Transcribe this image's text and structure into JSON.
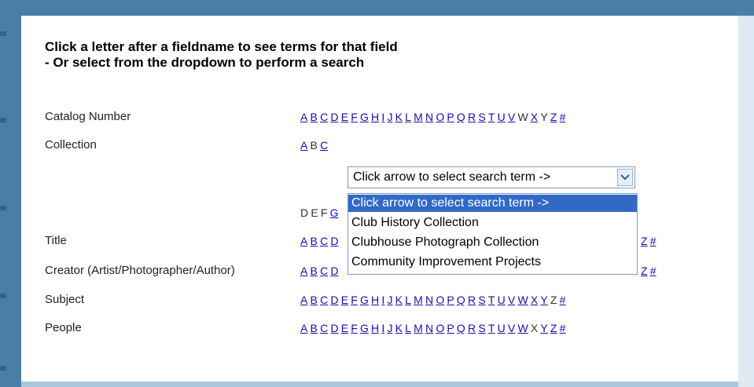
{
  "heading": {
    "line1": "Click a letter after a fieldname to see terms for that field",
    "line2": "- Or select from the dropdown to perform a search"
  },
  "fields": [
    {
      "label": "Catalog Number"
    },
    {
      "label": "Collection"
    },
    {
      "label": "Title"
    },
    {
      "label": "Creator (Artist/Photographer/Author)"
    },
    {
      "label": "Subject"
    },
    {
      "label": "People"
    }
  ],
  "letter_rows": {
    "catalog": [
      {
        "t": "A",
        "link": true
      },
      {
        "t": "B",
        "link": true
      },
      {
        "t": "C",
        "link": true
      },
      {
        "t": "D",
        "link": true
      },
      {
        "t": "E",
        "link": true
      },
      {
        "t": "F",
        "link": true
      },
      {
        "t": "G",
        "link": true
      },
      {
        "t": "H",
        "link": true
      },
      {
        "t": "I",
        "link": true
      },
      {
        "t": "J",
        "link": true
      },
      {
        "t": "K",
        "link": true
      },
      {
        "t": "L",
        "link": true
      },
      {
        "t": "M",
        "link": true
      },
      {
        "t": "N",
        "link": true
      },
      {
        "t": "O",
        "link": true
      },
      {
        "t": "P",
        "link": true
      },
      {
        "t": "Q",
        "link": true
      },
      {
        "t": "R",
        "link": true
      },
      {
        "t": "S",
        "link": true
      },
      {
        "t": "T",
        "link": true
      },
      {
        "t": "U",
        "link": true
      },
      {
        "t": "V",
        "link": true
      },
      {
        "t": "W",
        "link": false
      },
      {
        "t": "X",
        "link": true
      },
      {
        "t": "Y",
        "link": false
      },
      {
        "t": "Z",
        "link": true
      },
      {
        "t": "#",
        "link": true
      }
    ],
    "collection_top": [
      {
        "t": "A",
        "link": true
      },
      {
        "t": "B",
        "link": false
      },
      {
        "t": "C",
        "link": true
      }
    ],
    "collection_bottom": [
      {
        "t": "D",
        "link": false
      },
      {
        "t": "E",
        "link": false
      },
      {
        "t": "F",
        "link": false
      },
      {
        "t": "G",
        "link": true
      }
    ],
    "title": [
      {
        "t": "A",
        "link": true
      },
      {
        "t": "B",
        "link": true
      },
      {
        "t": "C",
        "link": true
      },
      {
        "t": "D",
        "link": true
      }
    ],
    "title_tail": [
      {
        "t": "Z",
        "link": true
      },
      {
        "t": "#",
        "link": true
      }
    ],
    "creator": [
      {
        "t": "A",
        "link": true
      },
      {
        "t": "B",
        "link": true
      },
      {
        "t": "C",
        "link": true
      },
      {
        "t": "D",
        "link": true
      }
    ],
    "creator_tail": [
      {
        "t": "Z",
        "link": true
      },
      {
        "t": "#",
        "link": true
      }
    ],
    "subject": [
      {
        "t": "A",
        "link": true
      },
      {
        "t": "B",
        "link": true
      },
      {
        "t": "C",
        "link": true
      },
      {
        "t": "D",
        "link": true
      },
      {
        "t": "E",
        "link": true
      },
      {
        "t": "F",
        "link": true
      },
      {
        "t": "G",
        "link": true
      },
      {
        "t": "H",
        "link": true
      },
      {
        "t": "I",
        "link": true
      },
      {
        "t": "J",
        "link": true
      },
      {
        "t": "K",
        "link": true
      },
      {
        "t": "L",
        "link": true
      },
      {
        "t": "M",
        "link": true
      },
      {
        "t": "N",
        "link": true
      },
      {
        "t": "O",
        "link": true
      },
      {
        "t": "P",
        "link": true
      },
      {
        "t": "Q",
        "link": true
      },
      {
        "t": "R",
        "link": true
      },
      {
        "t": "S",
        "link": true
      },
      {
        "t": "T",
        "link": true
      },
      {
        "t": "U",
        "link": true
      },
      {
        "t": "V",
        "link": true
      },
      {
        "t": "W",
        "link": true
      },
      {
        "t": "X",
        "link": true
      },
      {
        "t": "Y",
        "link": true
      },
      {
        "t": "Z",
        "link": false
      },
      {
        "t": "#",
        "link": true
      }
    ],
    "people": [
      {
        "t": "A",
        "link": true
      },
      {
        "t": "B",
        "link": true
      },
      {
        "t": "C",
        "link": true
      },
      {
        "t": "D",
        "link": true
      },
      {
        "t": "E",
        "link": true
      },
      {
        "t": "F",
        "link": true
      },
      {
        "t": "G",
        "link": true
      },
      {
        "t": "H",
        "link": true
      },
      {
        "t": "I",
        "link": true
      },
      {
        "t": "J",
        "link": true
      },
      {
        "t": "K",
        "link": true
      },
      {
        "t": "L",
        "link": true
      },
      {
        "t": "M",
        "link": true
      },
      {
        "t": "N",
        "link": true
      },
      {
        "t": "O",
        "link": true
      },
      {
        "t": "P",
        "link": true
      },
      {
        "t": "Q",
        "link": true
      },
      {
        "t": "R",
        "link": true
      },
      {
        "t": "S",
        "link": true
      },
      {
        "t": "T",
        "link": true
      },
      {
        "t": "U",
        "link": true
      },
      {
        "t": "V",
        "link": true
      },
      {
        "t": "W",
        "link": true
      },
      {
        "t": "X",
        "link": false
      },
      {
        "t": "Y",
        "link": true
      },
      {
        "t": "Z",
        "link": true
      },
      {
        "t": "#",
        "link": true
      }
    ]
  },
  "select": {
    "value": "Click arrow to select search term ->",
    "arrow_icon": "chevron-down-icon",
    "options": [
      "Click arrow to select search term ->",
      "Club History Collection",
      "Clubhouse Photograph Collection",
      "Community Improvement Projects"
    ]
  },
  "colors": {
    "frame": "#4a7fa5",
    "link": "#1a0dab",
    "selected_option": "#3169c6"
  }
}
